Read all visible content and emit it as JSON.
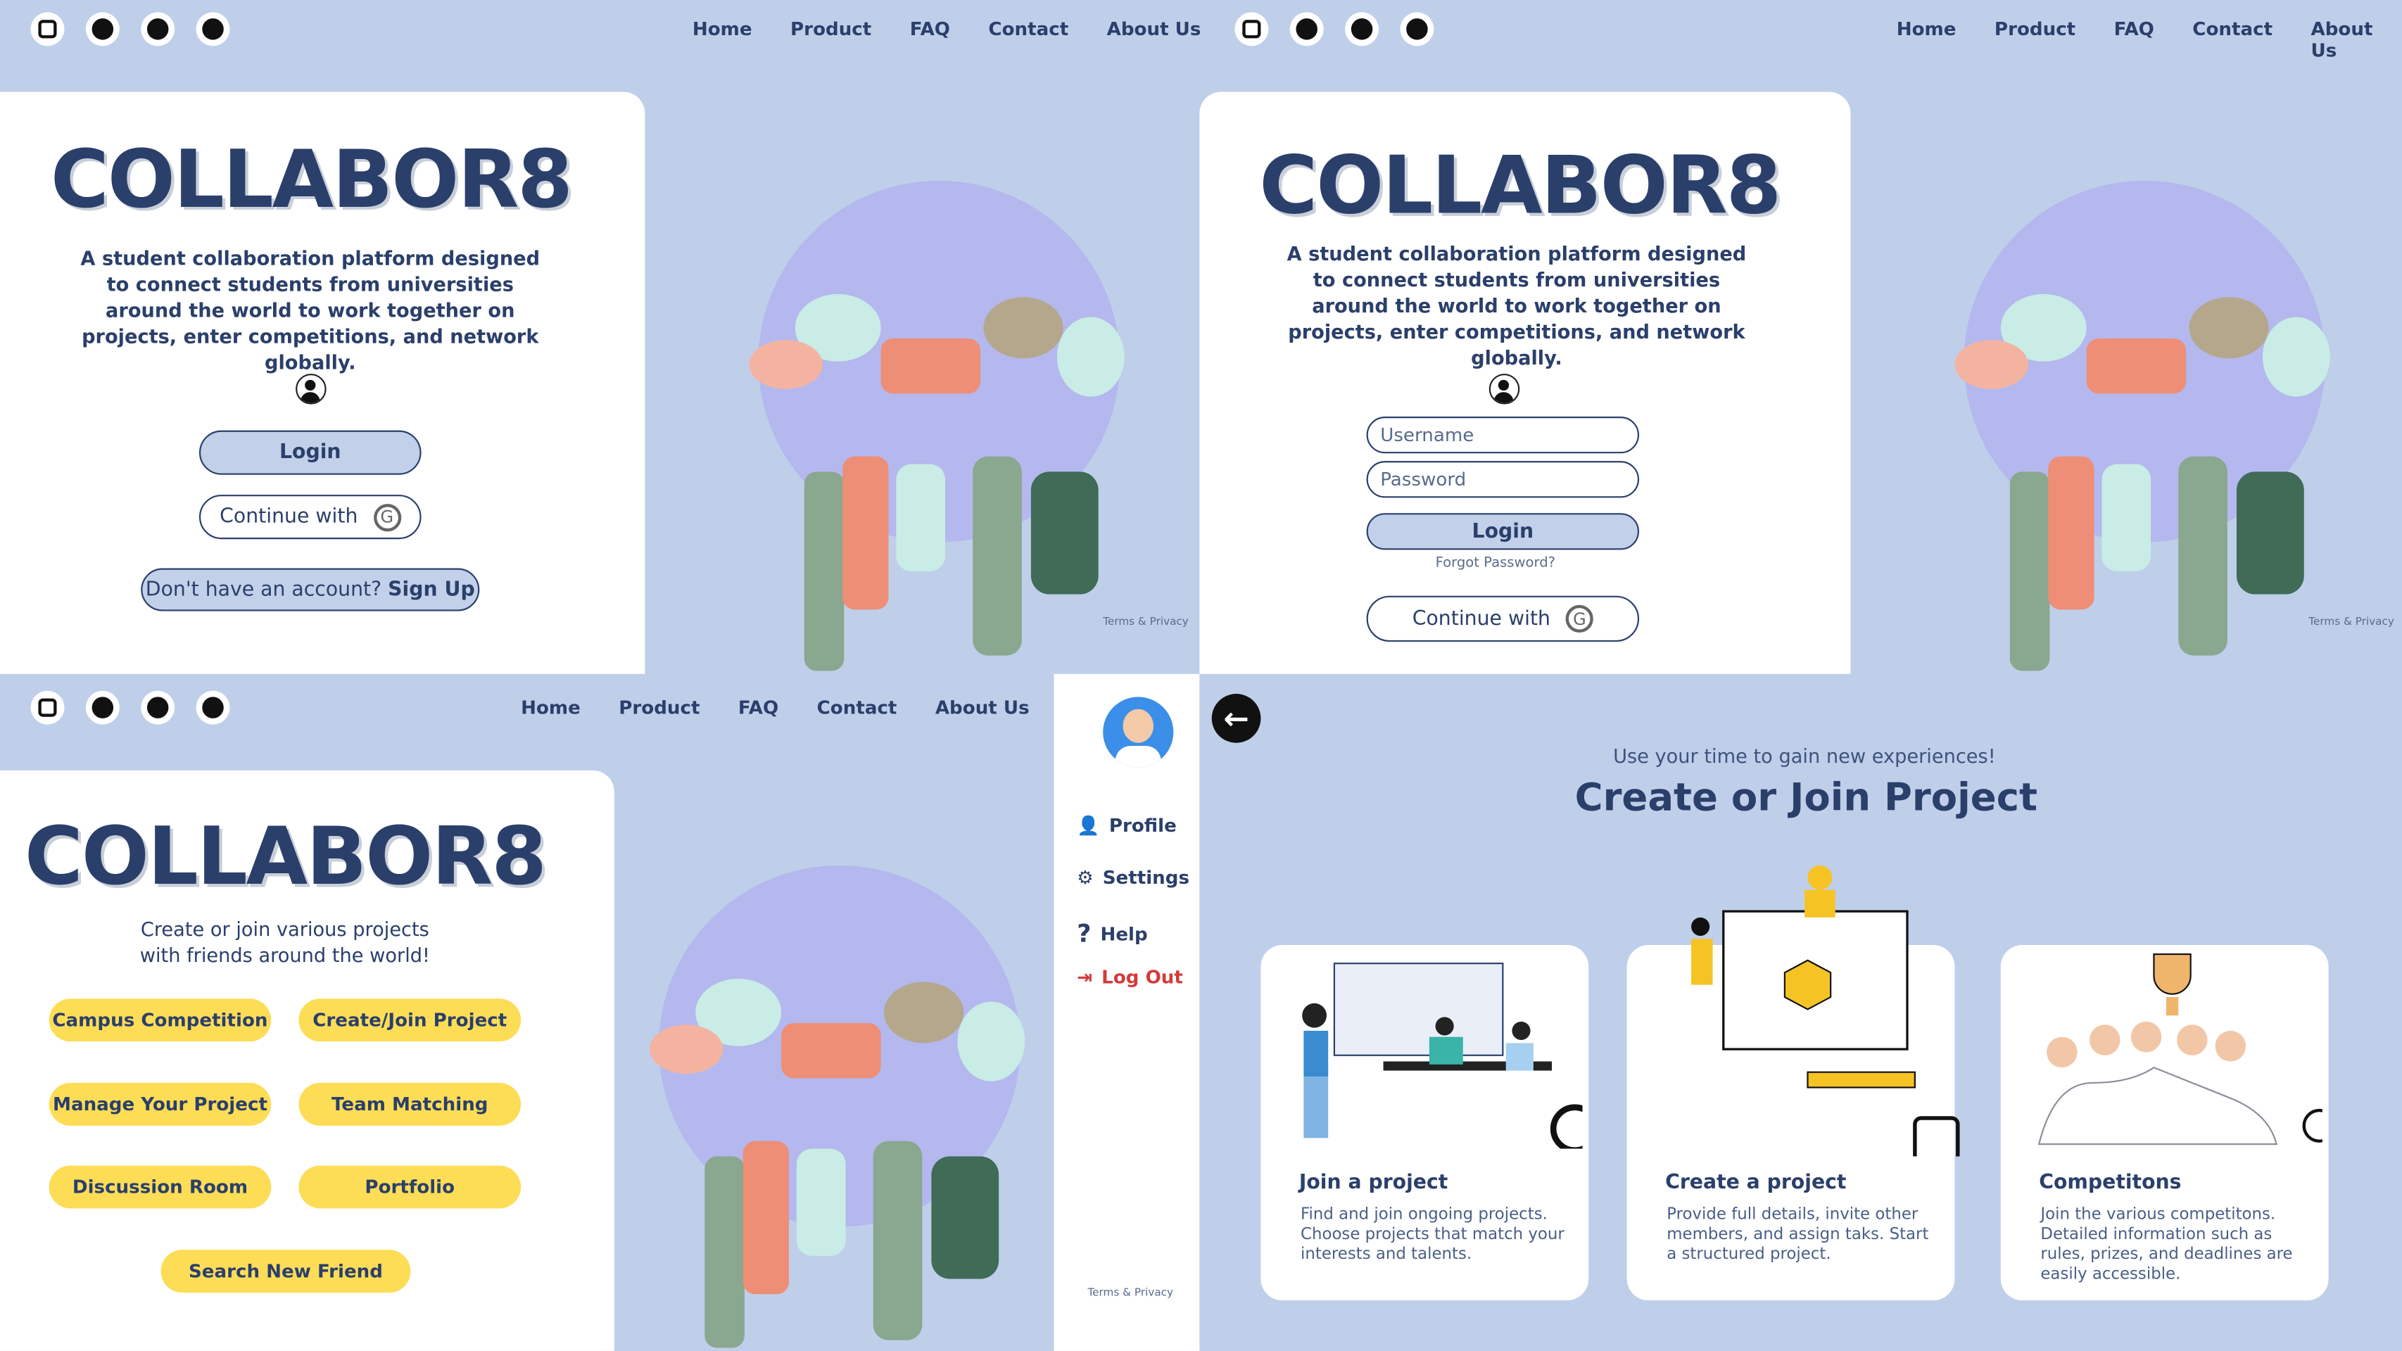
{
  "nav": [
    "Home",
    "Product",
    "FAQ",
    "Contact",
    "About Us"
  ],
  "social_icons": [
    "instagram-icon",
    "twitter-icon",
    "tiktok-icon",
    "youtube-icon"
  ],
  "logo": "COLLABOR8",
  "tagline_a": "A student collaboration platform designed to connect students from universities around the world to work together on projects, enter competitions, and network globally.",
  "tagline_b": "A student collaboration platform designed to connect students from universities around the world to work together on projects, enter competitions, and network globally.",
  "login": {
    "login": "Login",
    "continue_with": "Continue with",
    "no_account": "Don't have an account?",
    "signup": "Sign Up",
    "username": "Username",
    "password": "Password",
    "forgot": "Forgot Password?"
  },
  "terms": "Terms & Privacy",
  "home": {
    "subtitle": "Create or join various projects with friends around the world!",
    "buttons": [
      "Campus Competition",
      "Create/Join Project",
      "Manage Your Project",
      "Team Matching",
      "Discussion Room",
      "Portfolio",
      "Search New Friend"
    ]
  },
  "sidebar": [
    "Profile",
    "Settings",
    "Help",
    "Log Out"
  ],
  "project": {
    "kicker": "Use your time to gain new experiences!",
    "title": "Create or Join Project",
    "cards": [
      {
        "title": "Join a project",
        "desc": "Find and join ongoing projects. Choose projects that match your interests and talents."
      },
      {
        "title": "Create a project",
        "desc": "Provide full details, invite other members, and assign taks. Start a structured project."
      },
      {
        "title": "Competitons",
        "desc": "Join the various competitons. Detailed information such as rules, prizes, and deadlines are easily accessible."
      }
    ]
  },
  "colors": {
    "bg": "#bfcfea",
    "navy": "#2b3f6b",
    "yellow": "#fddd56",
    "logout": "#d33b3b"
  }
}
